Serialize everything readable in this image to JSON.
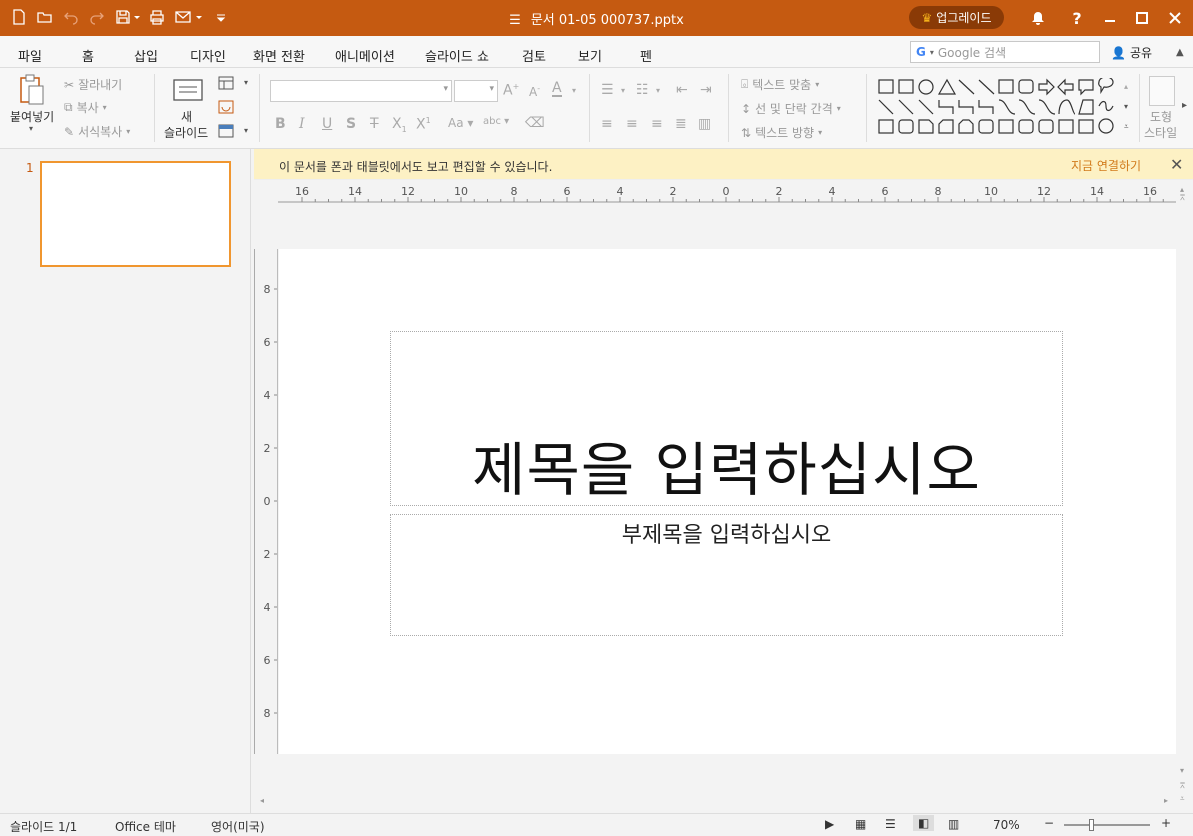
{
  "titlebar": {
    "doc_title": "문서 01-05 000737.pptx",
    "upgrade_label": "업그레이드",
    "accent_color": "#c55a11"
  },
  "menu": {
    "tabs": [
      "파일",
      "홈",
      "삽입",
      "디자인",
      "화면 전환",
      "애니메이션",
      "슬라이드 쇼",
      "검토",
      "보기",
      "펜"
    ],
    "active": "홈",
    "search_placeholder": "Google 검색",
    "share_label": "공유"
  },
  "ribbon": {
    "paste": "붙여넣기",
    "cut": "잘라내기",
    "copy": "복사",
    "format_painter": "서식복사",
    "new_slide_1": "새",
    "new_slide_2": "슬라이드",
    "text_fit": "텍스트 맞춤",
    "line_spacing": "선 및 단락 간격",
    "text_direction": "텍스트 방향",
    "shape_style_1": "도형",
    "shape_style_2": "스타일"
  },
  "notice": {
    "message": "이 문서를 폰과 태블릿에서도 보고 편집할 수 있습니다.",
    "link": "지금 연결하기"
  },
  "slides": {
    "thumb_number": "1"
  },
  "ruler": {
    "h_labels": [
      "16",
      "14",
      "12",
      "10",
      "8",
      "6",
      "4",
      "2",
      "0",
      "2",
      "4",
      "6",
      "8",
      "10",
      "12",
      "14",
      "16"
    ],
    "v_labels": [
      "8",
      "6",
      "4",
      "2",
      "0",
      "2",
      "4",
      "6",
      "8"
    ]
  },
  "slide": {
    "title_placeholder": "제목을 입력하십시오",
    "subtitle_placeholder": "부제목을 입력하십시오"
  },
  "status": {
    "slide_count": "슬라이드 1/1",
    "theme": "Office 테마",
    "language": "영어(미국)",
    "zoom": "70%"
  }
}
